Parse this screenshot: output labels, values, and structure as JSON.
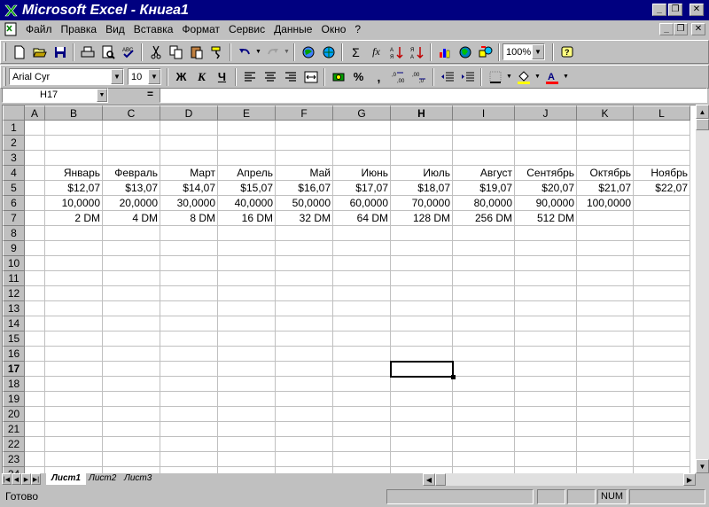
{
  "window": {
    "title": "Microsoft Excel - Книга1",
    "minimize": "_",
    "restore": "❐",
    "close": "✕"
  },
  "menu": {
    "items": [
      "Файл",
      "Правка",
      "Вид",
      "Вставка",
      "Формат",
      "Сервис",
      "Данные",
      "Окно",
      "?"
    ]
  },
  "toolbar": {
    "font_name": "Arial Cyr",
    "font_size": "10",
    "zoom": "100%",
    "bold": "Ж",
    "italic": "К",
    "underline": "Ч",
    "percent": "%",
    "comma": ",",
    "autosum": "Σ",
    "function": "fx"
  },
  "formula_bar": {
    "name_box": "H17",
    "equals": "=",
    "formula": ""
  },
  "grid": {
    "columns": [
      "A",
      "B",
      "C",
      "D",
      "E",
      "F",
      "G",
      "H",
      "I",
      "J",
      "K",
      "L"
    ],
    "active_column": "H",
    "rows": [
      "1",
      "2",
      "3",
      "4",
      "5",
      "6",
      "7",
      "8",
      "9",
      "10",
      "11",
      "12",
      "13",
      "14",
      "15",
      "16",
      "17",
      "18",
      "19",
      "20",
      "21",
      "22",
      "23",
      "24"
    ],
    "active_row": "17",
    "cells": {
      "row4": [
        "",
        "Январь",
        "Февраль",
        "Март",
        "Апрель",
        "Май",
        "Июнь",
        "Июль",
        "Август",
        "Сентябрь",
        "Октябрь",
        "Ноябрь"
      ],
      "row5": [
        "",
        "$12,07",
        "$13,07",
        "$14,07",
        "$15,07",
        "$16,07",
        "$17,07",
        "$18,07",
        "$19,07",
        "$20,07",
        "$21,07",
        "$22,07"
      ],
      "row6": [
        "",
        "10,0000",
        "20,0000",
        "30,0000",
        "40,0000",
        "50,0000",
        "60,0000",
        "70,0000",
        "80,0000",
        "90,0000",
        "100,0000",
        ""
      ],
      "row7": [
        "",
        "2 DM",
        "4 DM",
        "8 DM",
        "16 DM",
        "32 DM",
        "64 DM",
        "128 DM",
        "256 DM",
        "512 DM",
        "",
        ""
      ]
    }
  },
  "sheets": {
    "tabs": [
      "Лист1",
      "Лист2",
      "Лист3"
    ],
    "active": "Лист1"
  },
  "status": {
    "text": "Готово",
    "num": "NUM"
  }
}
